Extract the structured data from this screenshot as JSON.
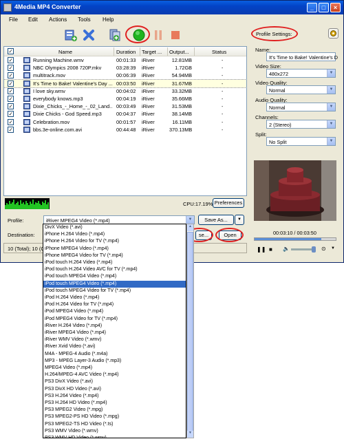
{
  "app": {
    "title": "4Media MP4 Converter"
  },
  "menu": [
    "File",
    "Edit",
    "Actions",
    "Tools",
    "Help"
  ],
  "table": {
    "headers": {
      "name": "Name",
      "duration": "Duration",
      "target": "Target ...",
      "output": "Output...",
      "status": "Status"
    },
    "rows": [
      {
        "name": "Running Machine.wmv",
        "duration": "00:01:33",
        "target": "iRiver",
        "output": "12.81MB",
        "status": "-",
        "selected": false
      },
      {
        "name": "NBC Olympics 2008 720P.mkv",
        "duration": "03:28:39",
        "target": "iRiver",
        "output": "1.72GB",
        "status": "-",
        "selected": false
      },
      {
        "name": "multitrack.mov",
        "duration": "00:06:39",
        "target": "iRiver",
        "output": "54.94MB",
        "status": "-",
        "selected": false
      },
      {
        "name": "It's Time to Bake! Valentine's Day ...",
        "duration": "00:03:50",
        "target": "iRiver",
        "output": "31.67MB",
        "status": "-",
        "selected": true
      },
      {
        "name": "I love sky.wmv",
        "duration": "00:04:02",
        "target": "iRiver",
        "output": "33.32MB",
        "status": "-",
        "selected": false
      },
      {
        "name": "everybody knows.mp3",
        "duration": "00:04:19",
        "target": "iRiver",
        "output": "35.66MB",
        "status": "-",
        "selected": false
      },
      {
        "name": "Dixie_Chicks_-_Home_-_02_Land...",
        "duration": "00:03:49",
        "target": "iRiver",
        "output": "31.53MB",
        "status": "-",
        "selected": false
      },
      {
        "name": "Dixie Chicks - God Speed.mp3",
        "duration": "00:04:37",
        "target": "iRiver",
        "output": "38.14MB",
        "status": "-",
        "selected": false
      },
      {
        "name": "Celebration.mov",
        "duration": "00:01:57",
        "target": "iRiver",
        "output": "16.11MB",
        "status": "-",
        "selected": false
      },
      {
        "name": "bbs.3e-online.com.avi",
        "duration": "00:44:48",
        "target": "iRiver",
        "output": "370.13MB",
        "status": "-",
        "selected": false
      }
    ]
  },
  "cpu": {
    "text": "CPU:17.19%"
  },
  "buttons": {
    "preferences": "Preferences",
    "save_as": "Save As...",
    "browse": "se...",
    "open": "Open"
  },
  "profile": {
    "label": "Profile:",
    "value": "iRiver MPEG4 Video (*.mp4)"
  },
  "destination": {
    "label": "Destination:"
  },
  "status_bar": {
    "text": "10 (Total); 10 (C"
  },
  "profile_list": {
    "selected_index": 8,
    "items": [
      "DivX Video (*.avi)",
      "iPhone H.264 Video (*.mp4)",
      "iPhone H.264 Video for TV (*.mp4)",
      "iPhone MPEG4 Video (*.mp4)",
      "iPhone MPEG4 Video for TV (*.mp4)",
      "iPod touch H.264 Video (*.mp4)",
      "iPod touch H.264 Video AVC for TV (*.mp4)",
      "iPod touch MPEG4 Video (*.mp4)",
      "iPod touch MPEG4 Video (*.mp4)",
      "iPod touch MPEG4 Video for TV (*.mp4)",
      "iPod H.264 Video (*.mp4)",
      "iPod H.264 Video for TV (*.mp4)",
      "iPod MPEG4 Video (*.mp4)",
      "iPod MPEG4 Video for TV (*.mp4)",
      "iRiver H.264 Video (*.mp4)",
      "iRiver MPEG4 Video (*.mp4)",
      "iRiver WMV Video (*.wmv)",
      "iRiver Xvid Video (*.avi)",
      "M4A - MPEG-4 Audio (*.m4a)",
      "MP3 - MPEG Layer-3 Audio (*.mp3)",
      "MPEG4 Video (*.mp4)",
      "H.264/MPEG-4 AVC Video (*.mp4)",
      "PS3 DivX Video (*.avi)",
      "PS3 DivX HD Video (*.avi)",
      "PS3 H.264 Video (*.mp4)",
      "PS3 H.264 HD Video (*.mp4)",
      "PS3 MPEG2 Video (*.mpg)",
      "PS3 MPEG2-PS HD Video (*.mpg)",
      "PS3 MPEG2-TS HD Video (*.ts)",
      "PS3 WMV Video (*.wmv)",
      "PS3 WMV HD Video (*.wmv)"
    ]
  },
  "settings": {
    "title": "Profile Settings:",
    "name_label": "Name:",
    "name_value": "It's Time to Bake! Valentine's D",
    "video_size_label": "Video Size:",
    "video_size_value": "480x272",
    "video_quality_label": "Video Quality:",
    "video_quality_value": "Normal",
    "audio_quality_label": "Audio Quality:",
    "audio_quality_value": "Normal",
    "channels_label": "Channels:",
    "channels_value": "2 (Stereo)",
    "split_label": "Split:",
    "split_value": "No Split"
  },
  "player": {
    "time": "00:03:10 / 00:03:50",
    "progress": 0.826
  },
  "colors": {
    "accent_ring": "#e02020",
    "selection": "#316ac5",
    "title_bar": "#0343c6"
  }
}
